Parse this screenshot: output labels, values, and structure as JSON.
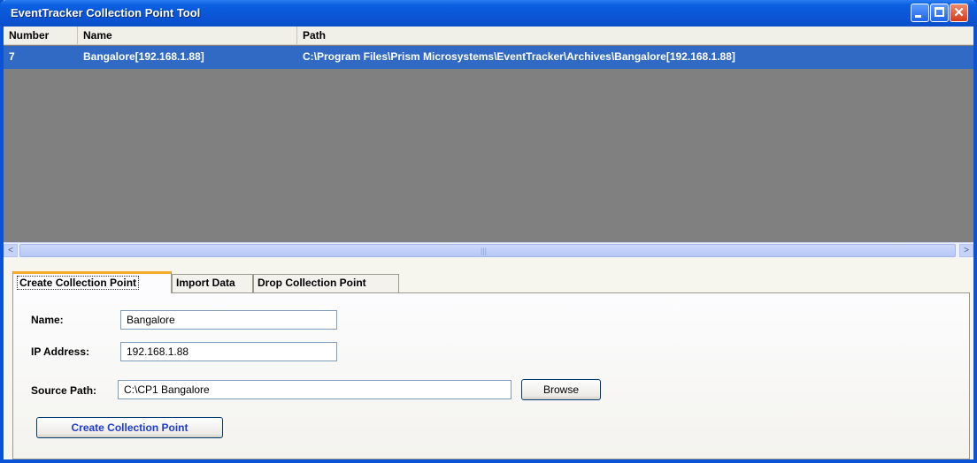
{
  "window": {
    "title": "EventTracker Collection Point Tool"
  },
  "list": {
    "columns": [
      "Number",
      "Name",
      "Path"
    ],
    "rows": [
      {
        "number": "7",
        "name": "Bangalore[192.168.1.88]",
        "path": "C:\\Program Files\\Prism Microsystems\\EventTracker\\Archives\\Bangalore[192.168.1.88]"
      }
    ]
  },
  "tabs": [
    {
      "label": "Create Collection Point"
    },
    {
      "label": "Import Data"
    },
    {
      "label": "Drop Collection Point"
    }
  ],
  "form": {
    "name_label": "Name:",
    "name_value": "Bangalore",
    "ip_label": "IP Address:",
    "ip_value": "192.168.1.88",
    "source_label": "Source Path:",
    "source_value": "C:\\CP1 Bangalore",
    "browse_label": "Browse",
    "create_label": "Create Collection Point"
  },
  "colors": {
    "titlebar": "#0a5fe0",
    "selection": "#316ac5",
    "list_background": "#808080",
    "active_tab_accent": "#f4a92a"
  }
}
